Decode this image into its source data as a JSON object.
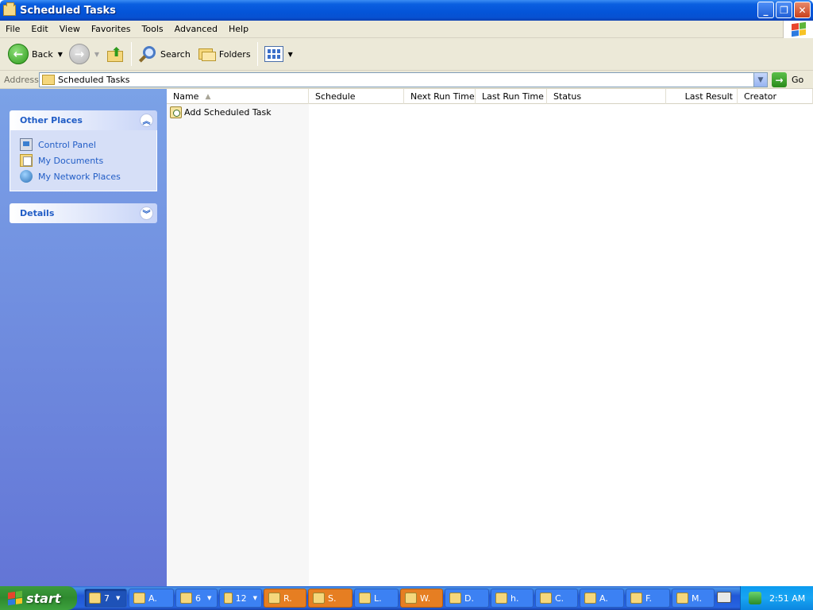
{
  "window": {
    "title": "Scheduled Tasks",
    "minimize": "_",
    "restore": "❐",
    "close": "✕"
  },
  "menu": [
    "File",
    "Edit",
    "View",
    "Favorites",
    "Tools",
    "Advanced",
    "Help"
  ],
  "toolbar": {
    "back_label": "Back",
    "search_label": "Search",
    "folders_label": "Folders"
  },
  "address": {
    "label": "Address",
    "value": "Scheduled Tasks",
    "go_label": "Go"
  },
  "taskpane": {
    "other_places": {
      "title": "Other Places",
      "items": [
        {
          "label": "Control Panel",
          "icon": "control-panel-icon"
        },
        {
          "label": "My Documents",
          "icon": "my-documents-icon"
        },
        {
          "label": "My Network Places",
          "icon": "network-places-icon"
        }
      ]
    },
    "details": {
      "title": "Details"
    }
  },
  "list": {
    "columns": [
      "Name",
      "Schedule",
      "Next Run Time",
      "Last Run Time",
      "Status",
      "Last Result",
      "Creator"
    ],
    "sorted_by": "Name",
    "rows": [
      {
        "name": "Add Scheduled Task",
        "icon": "add-task-icon"
      }
    ]
  },
  "taskbar": {
    "start_label": "start",
    "buttons": [
      {
        "label": "7",
        "style": "active",
        "dropdown": true
      },
      {
        "label": "A.",
        "style": "normal",
        "dropdown": false
      },
      {
        "label": "6",
        "style": "normal",
        "dropdown": true
      },
      {
        "label": "12",
        "style": "normal",
        "dropdown": true
      },
      {
        "label": "R.",
        "style": "orange",
        "dropdown": false
      },
      {
        "label": "S.",
        "style": "orange",
        "dropdown": false
      },
      {
        "label": "L.",
        "style": "normal",
        "dropdown": false
      },
      {
        "label": "W.",
        "style": "orange",
        "dropdown": false
      },
      {
        "label": "D.",
        "style": "normal",
        "dropdown": false
      },
      {
        "label": "h.",
        "style": "normal",
        "dropdown": false
      },
      {
        "label": "C.",
        "style": "normal",
        "dropdown": false
      },
      {
        "label": "A.",
        "style": "normal",
        "dropdown": false
      },
      {
        "label": "F.",
        "style": "normal",
        "dropdown": false
      },
      {
        "label": "M.",
        "style": "normal",
        "dropdown": false
      }
    ],
    "clock": "2:51 AM"
  }
}
